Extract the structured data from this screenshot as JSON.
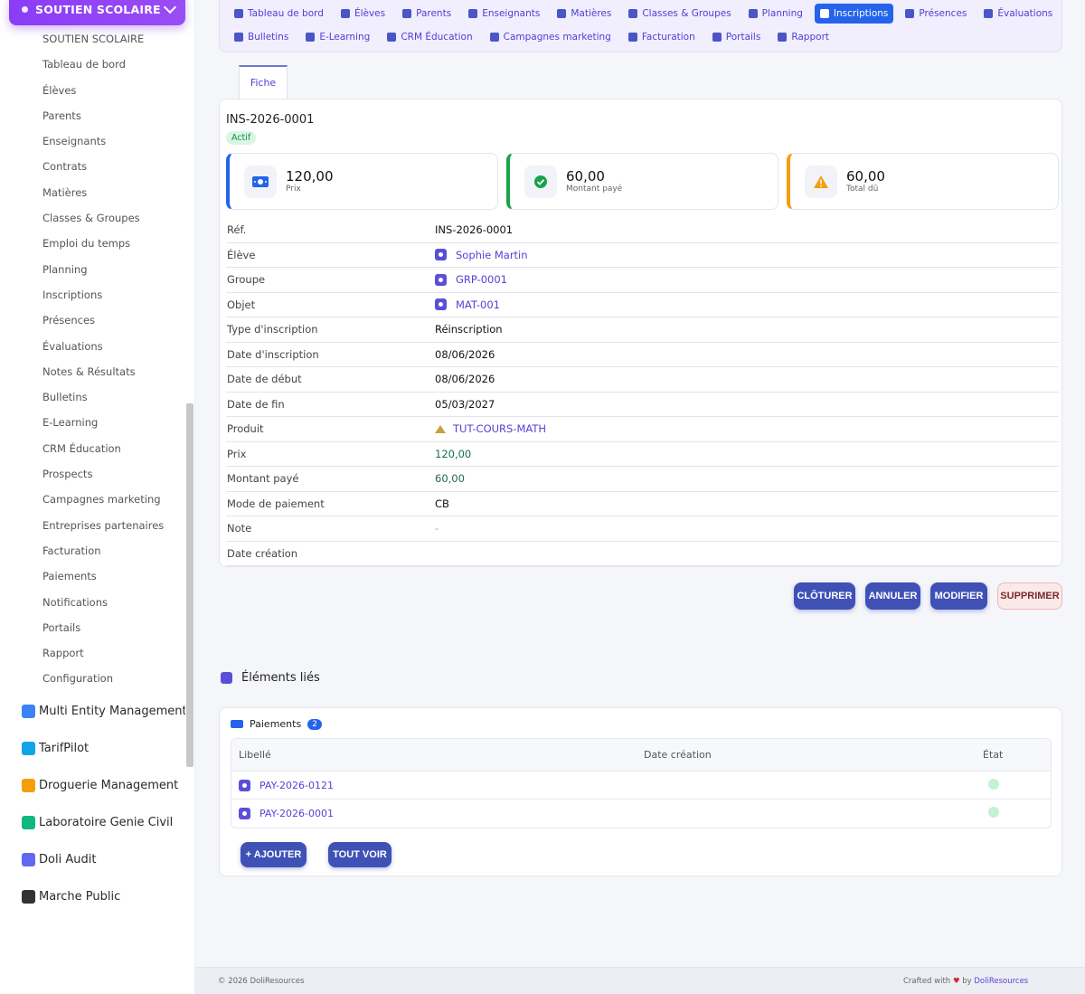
{
  "sidebar": {
    "header": "SOUTIEN SCOLAIRE",
    "items": [
      "SOUTIEN SCOLAIRE",
      "Tableau de bord",
      "Élèves",
      "Parents",
      "Enseignants",
      "Contrats",
      "Matières",
      "Classes & Groupes",
      "Emploi du temps",
      "Planning",
      "Inscriptions",
      "Présences",
      "Évaluations",
      "Notes & Résultats",
      "Bulletins",
      "E-Learning",
      "CRM Éducation",
      "Prospects",
      "Campagnes marketing",
      "Entreprises partenaires",
      "Facturation",
      "Paiements",
      "Notifications",
      "Portails",
      "Rapport",
      "Configuration"
    ],
    "modules": [
      "Multi Entity Management",
      "TarifPilot",
      "Droguerie Management",
      "Laboratoire Genie Civil",
      "Doli Audit",
      "Marche Public"
    ]
  },
  "topnav": {
    "row1": [
      "Tableau de bord",
      "Élèves",
      "Parents",
      "Enseignants",
      "Matières",
      "Classes & Groupes",
      "Planning",
      "Inscriptions",
      "Présences",
      "Évaluations"
    ],
    "row2": [
      "Bulletins",
      "E-Learning",
      "CRM Éducation",
      "Campagnes marketing",
      "Facturation",
      "Portails",
      "Rapport"
    ],
    "active": "Inscriptions"
  },
  "tab": "Fiche",
  "record": {
    "ref": "INS-2026-0001",
    "status": "Actif",
    "stats": [
      {
        "value": "120,00",
        "label": "Prix",
        "icon": "money-icon",
        "color": "#2563eb"
      },
      {
        "value": "60,00",
        "label": "Montant payé",
        "icon": "check-circle-icon",
        "color": "#16a34a"
      },
      {
        "value": "60,00",
        "label": "Total dû",
        "icon": "warning-icon",
        "color": "#f59e0b"
      }
    ],
    "fields": [
      {
        "label": "Réf.",
        "value": "INS-2026-0001",
        "kind": "plain"
      },
      {
        "label": "Élève",
        "value": "Sophie Martin",
        "kind": "link"
      },
      {
        "label": "Groupe",
        "value": "GRP-0001",
        "kind": "link"
      },
      {
        "label": "Objet",
        "value": "MAT-001",
        "kind": "link"
      },
      {
        "label": "Type d'inscription",
        "value": "Réinscription",
        "kind": "plain"
      },
      {
        "label": "Date d'inscription",
        "value": "08/06/2026",
        "kind": "plain"
      },
      {
        "label": "Date de début",
        "value": "08/06/2026",
        "kind": "plain"
      },
      {
        "label": "Date de fin",
        "value": "05/03/2027",
        "kind": "plain"
      },
      {
        "label": "Produit",
        "value": "TUT-COURS-MATH",
        "kind": "product"
      },
      {
        "label": "Prix",
        "value": "120,00",
        "kind": "money"
      },
      {
        "label": "Montant payé",
        "value": "60,00",
        "kind": "money"
      },
      {
        "label": "Mode de paiement",
        "value": "CB",
        "kind": "plain"
      },
      {
        "label": "Note",
        "value": "-",
        "kind": "muted"
      },
      {
        "label": "Date création",
        "value": "",
        "kind": "plain"
      }
    ]
  },
  "actions": {
    "close": "CLÔTURER",
    "cancel": "ANNULER",
    "edit": "MODIFIER",
    "delete": "SUPPRIMER"
  },
  "linked": {
    "title": "Éléments liés",
    "payments": {
      "title": "Paiements",
      "count": "2",
      "columns": [
        "Libellé",
        "Date création",
        "État"
      ],
      "rows": [
        {
          "label": "PAY-2026-0121",
          "date": ""
        },
        {
          "label": "PAY-2026-0001",
          "date": ""
        }
      ],
      "add": "+ AJOUTER",
      "view_all": "TOUT VOIR"
    }
  },
  "footer": {
    "left": "© 2026 DoliResources",
    "crafted": "Crafted with",
    "by": "by",
    "brand": "DoliResources"
  }
}
